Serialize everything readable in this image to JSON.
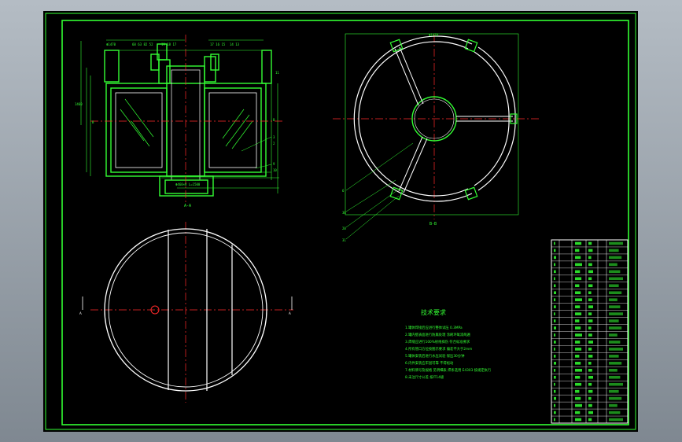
{
  "colors": {
    "background": "#000000",
    "border": "#33ff33",
    "line": "#ffffff",
    "accent": "#00ff00",
    "center_line": "#ff2a2a"
  },
  "views": {
    "section_a_label": "A-A",
    "section_b_label": "B-B",
    "cut_marks": {
      "top_left": "B",
      "top_right": "B",
      "bottom_left": "A",
      "bottom_right": "A"
    }
  },
  "tech_requirements": {
    "title": "技术要求",
    "lines": [
      "1.罐体焊接后应进行整体试压 0.3MPa",
      "2.罐内壁表面进行防腐处理 涂刷环氧漆两遍",
      "3.焊缝应进行100%射线探伤 符合标准要求",
      "4.所有管口方位按图示要求 偏差不大于2mm",
      "5.罐体安装后进行水压试验 保压30分钟",
      "6.内件安装应牢固可靠 不得松动",
      "7.材料牌号及规格 见明细表 焊条选用 E4303 按规定执行",
      "8.未注尺寸公差 按IT14级"
    ]
  },
  "title_block": {
    "rows": 26
  }
}
